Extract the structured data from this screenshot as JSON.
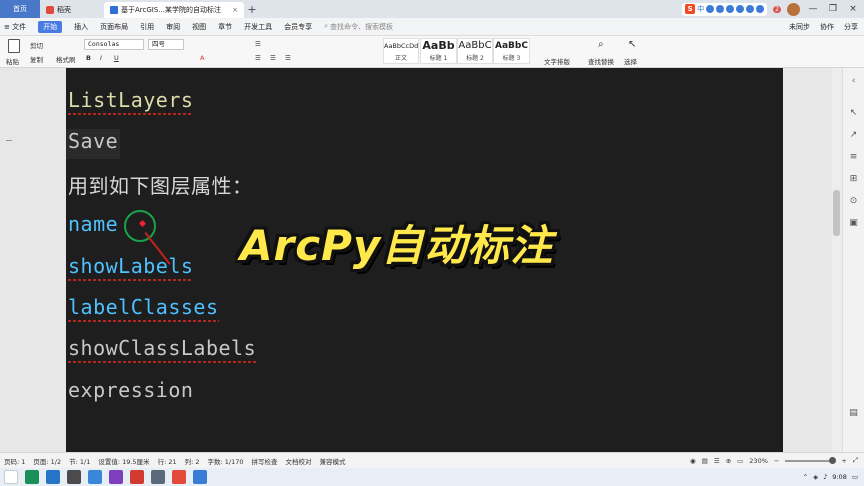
{
  "titlebar": {
    "home_tab": "首页",
    "daoke_tab": "稻壳",
    "doc_tab": "基于ArcGIS...某学院的自动标注",
    "close": "×",
    "new_tab": "+",
    "sogou_logo": "S",
    "sogou_text": "中",
    "notif_count": "2",
    "window_min": "—",
    "window_max": "❐",
    "window_close": "×"
  },
  "menubar": {
    "file": "≡ 文件",
    "items": [
      "开始",
      "插入",
      "页面布局",
      "引用",
      "审阅",
      "视图",
      "章节",
      "开发工具",
      "会员专享"
    ],
    "search": "查找命令、搜索模板",
    "unsync": "未同步",
    "collab": "协作",
    "share": "分享"
  },
  "ribbon": {
    "paste": "粘贴",
    "cut": "剪切",
    "copy": "复制",
    "format_painter": "格式刷",
    "font_name": "Consolas",
    "font_size": "四号",
    "styles": [
      {
        "sample": "AaBbCcDd",
        "name": "正文"
      },
      {
        "sample": "AaBb",
        "name": "标题 1"
      },
      {
        "sample": "AaBbC",
        "name": "标题 2"
      },
      {
        "sample": "AaBbC",
        "name": "标题 3"
      }
    ],
    "text_layout": "文字排版",
    "find_replace": "查找替换",
    "select": "选择"
  },
  "document": {
    "lines": [
      {
        "text": "ListLayers",
        "style": "yellow"
      },
      {
        "text": "Save",
        "style": "grey"
      },
      {
        "text": "用到如下图层属性：",
        "style": "cn"
      },
      {
        "text": "name",
        "style": "blue"
      },
      {
        "text": "showLabels",
        "style": "blue"
      },
      {
        "text": "labelClasses",
        "style": "blue"
      },
      {
        "text": "showClassLabels",
        "style": "blue"
      },
      {
        "text": "expression",
        "style": "grey"
      }
    ],
    "overlay_title": "ArcPy自动标注"
  },
  "statusbar": {
    "page_num": "页码: 1",
    "pages": "页面: 1/2",
    "section": "节: 1/1",
    "setting": "设置值: 19.5厘米",
    "row": "行: 21",
    "col": "列: 2",
    "words": "字数: 1/170",
    "spell": "拼写检查",
    "proof": "文档校对",
    "compat": "兼容模式",
    "zoom": "230%"
  },
  "taskbar": {
    "time": "9:08"
  }
}
